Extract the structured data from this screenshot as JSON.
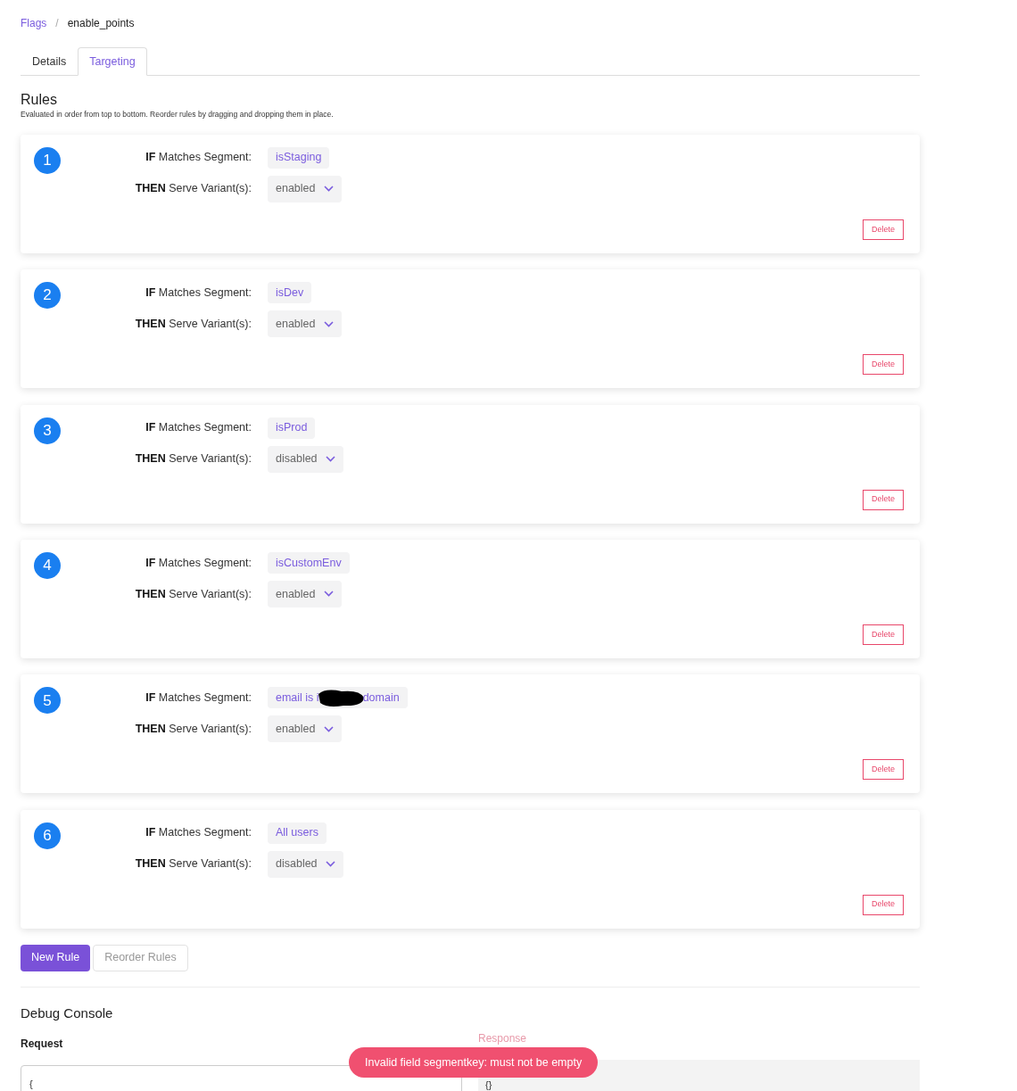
{
  "breadcrumb": [
    {
      "label": "Flags",
      "link": true
    },
    {
      "label": "enable_points",
      "link": false,
      "separator": "/"
    }
  ],
  "tabs": [
    {
      "label": "Details",
      "selected": false
    },
    {
      "label": "Targeting",
      "selected": true
    }
  ],
  "rules_section": {
    "title": "Rules",
    "description": "Evaluated in order from top to bottom. Reorder rules by dragging and dropping them in place."
  },
  "rules": [
    {
      "number": "1",
      "if_keyword": "IF",
      "if_label": "Matches Segment:",
      "segment_parts": [
        "isStaging"
      ],
      "then_keyword": "THEN",
      "then_label": "Serve Variant(s):",
      "variant": "enabled",
      "delete": "Delete"
    },
    {
      "number": "2",
      "if_keyword": "IF",
      "if_label": "Matches Segment:",
      "segment_parts": [
        "isDev"
      ],
      "then_keyword": "THEN",
      "then_label": "Serve Variant(s):",
      "variant": "enabled",
      "delete": "Delete"
    },
    {
      "number": "3",
      "if_keyword": "IF",
      "if_label": "Matches Segment:",
      "segment_parts": [
        "isProd"
      ],
      "then_keyword": "THEN",
      "then_label": "Serve Variant(s):",
      "variant": "disabled",
      "delete": "Delete"
    },
    {
      "number": "4",
      "if_keyword": "IF",
      "if_label": "Matches Segment:",
      "segment_parts": [
        "isCustomEnv"
      ],
      "then_keyword": "THEN",
      "then_label": "Serve Variant(s):",
      "variant": "enabled",
      "delete": "Delete"
    },
    {
      "number": "5",
      "if_keyword": "IF",
      "if_label": "Matches Segment:",
      "segment_parts": [
        "email is i",
        "domain"
      ],
      "then_keyword": "THEN",
      "then_label": "Serve Variant(s):",
      "variant": "enabled",
      "delete": "Delete"
    },
    {
      "number": "6",
      "if_keyword": "IF",
      "if_label": "Matches Segment:",
      "segment_parts": [
        "All users"
      ],
      "then_keyword": "THEN",
      "then_label": "Serve Variant(s):",
      "variant": "disabled",
      "delete": "Delete"
    }
  ],
  "actions": [
    {
      "label": "New Rule",
      "kind": "primary"
    },
    {
      "label": "Reorder Rules",
      "kind": "secondary"
    }
  ],
  "debug_console": {
    "title": "Debug Console",
    "request_label": "Request",
    "request_value": "{",
    "response_label": "Response",
    "response_value": "{}"
  },
  "toast": {
    "message": "Invalid field segmentkey: must not be empty"
  }
}
